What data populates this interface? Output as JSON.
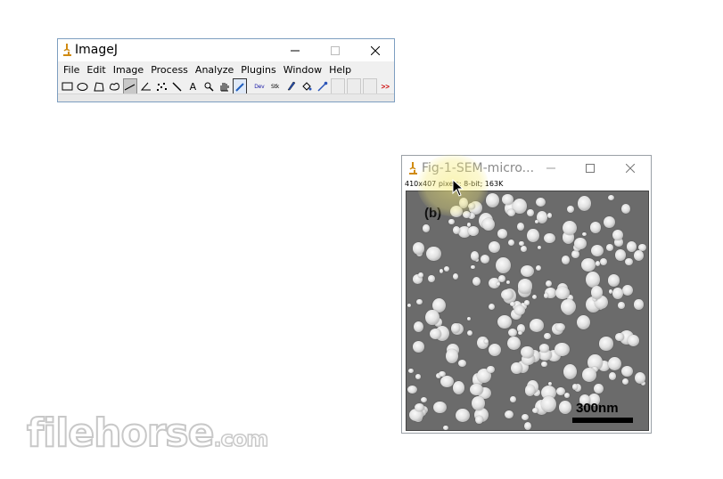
{
  "imagej_window": {
    "title": "ImageJ",
    "menus": [
      "File",
      "Edit",
      "Image",
      "Process",
      "Analyze",
      "Plugins",
      "Window",
      "Help"
    ],
    "toolbar": {
      "text_tool_label": "A",
      "dev_label": "Dev",
      "stk_label": "Stk",
      "more_label": ">>"
    }
  },
  "image_window": {
    "title": "Fig-1-SEM-micro...",
    "info": "410x407 pixels; 8-bit; 163K",
    "panel_label": "(b)",
    "scale_label": "300nm"
  },
  "watermark": {
    "text": "filehorse",
    "suffix": ".com"
  },
  "colors": {
    "window_border": "#7d9ec0",
    "more_arrow": "#cc0000",
    "sem_background": "#6b6b6b"
  }
}
